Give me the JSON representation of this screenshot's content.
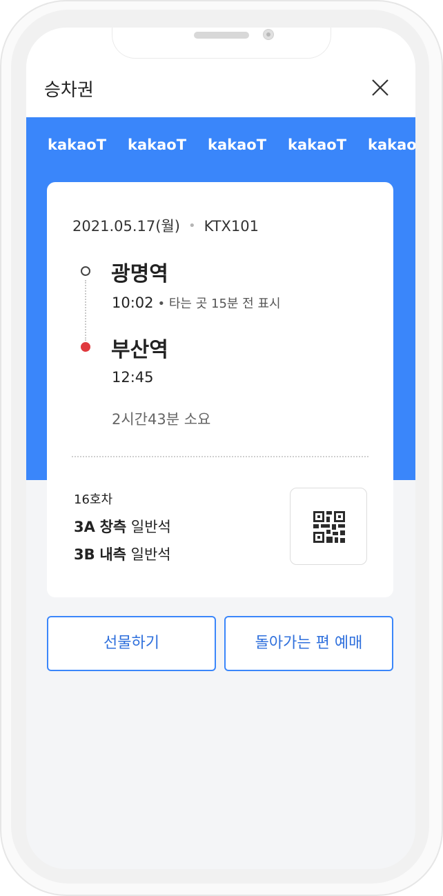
{
  "header": {
    "title": "승차권"
  },
  "banner": {
    "brand": [
      "kakaoT",
      "kakaoT",
      "kakaoT",
      "kakaoT",
      "kakaoT"
    ]
  },
  "ticket": {
    "date": "2021.05.17(월)",
    "train": "KTX101",
    "origin": {
      "station": "광명역",
      "time": "10:02",
      "note": "• 타는 곳 15분 전 표시"
    },
    "destination": {
      "station": "부산역",
      "time": "12:45"
    },
    "duration": "2시간43분 소요",
    "car": "16호차",
    "seats": [
      {
        "seat": "3A",
        "side": "창측",
        "class": "일반석"
      },
      {
        "seat": "3B",
        "side": "내측",
        "class": "일반석"
      }
    ]
  },
  "actions": {
    "gift": "선물하기",
    "return_trip": "돌아가는 편 예매"
  },
  "colors": {
    "brand_blue": "#3a86fa",
    "destination_dot": "#e0393e"
  }
}
